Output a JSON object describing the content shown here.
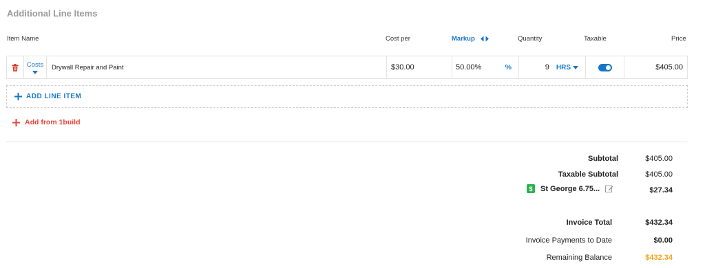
{
  "section": {
    "title": "Additional Line Items"
  },
  "headers": {
    "item_name": "Item Name",
    "cost_per": "Cost per",
    "markup": "Markup",
    "quantity": "Quantity",
    "taxable": "Taxable",
    "price": "Price"
  },
  "line_items": [
    {
      "category": "Costs",
      "name": "Drywall Repair and Paint",
      "cost_per": "$30.00",
      "markup": "50.00%",
      "markup_unit": "%",
      "quantity": "9",
      "unit": "HRS",
      "taxable": true,
      "price": "$405.00"
    }
  ],
  "actions": {
    "add_line_item": "ADD LINE ITEM",
    "add_from_1build": "Add from 1build"
  },
  "totals": {
    "subtotal_label": "Subtotal",
    "subtotal_value": "$405.00",
    "taxable_subtotal_label": "Taxable Subtotal",
    "taxable_subtotal_value": "$405.00",
    "tax_name": "St George 6.75...",
    "tax_value": "$27.34",
    "invoice_total_label": "Invoice Total",
    "invoice_total_value": "$432.34",
    "payments_label": "Invoice Payments to Date",
    "payments_value": "$0.00",
    "remaining_label": "Remaining Balance",
    "remaining_value": "$432.34"
  },
  "colors": {
    "accent": "#1676c8",
    "danger": "#e8443a",
    "balance": "#f2a31b",
    "tax_icon": "#2bb34b"
  },
  "icons": {
    "delete": "trash-icon",
    "category_dropdown": "caret-down-icon",
    "markup_toggle": "swap-arrows-icon",
    "unit_dropdown": "caret-down-icon",
    "add": "plus-icon",
    "tax": "tax-rate-icon",
    "edit": "edit-icon"
  }
}
